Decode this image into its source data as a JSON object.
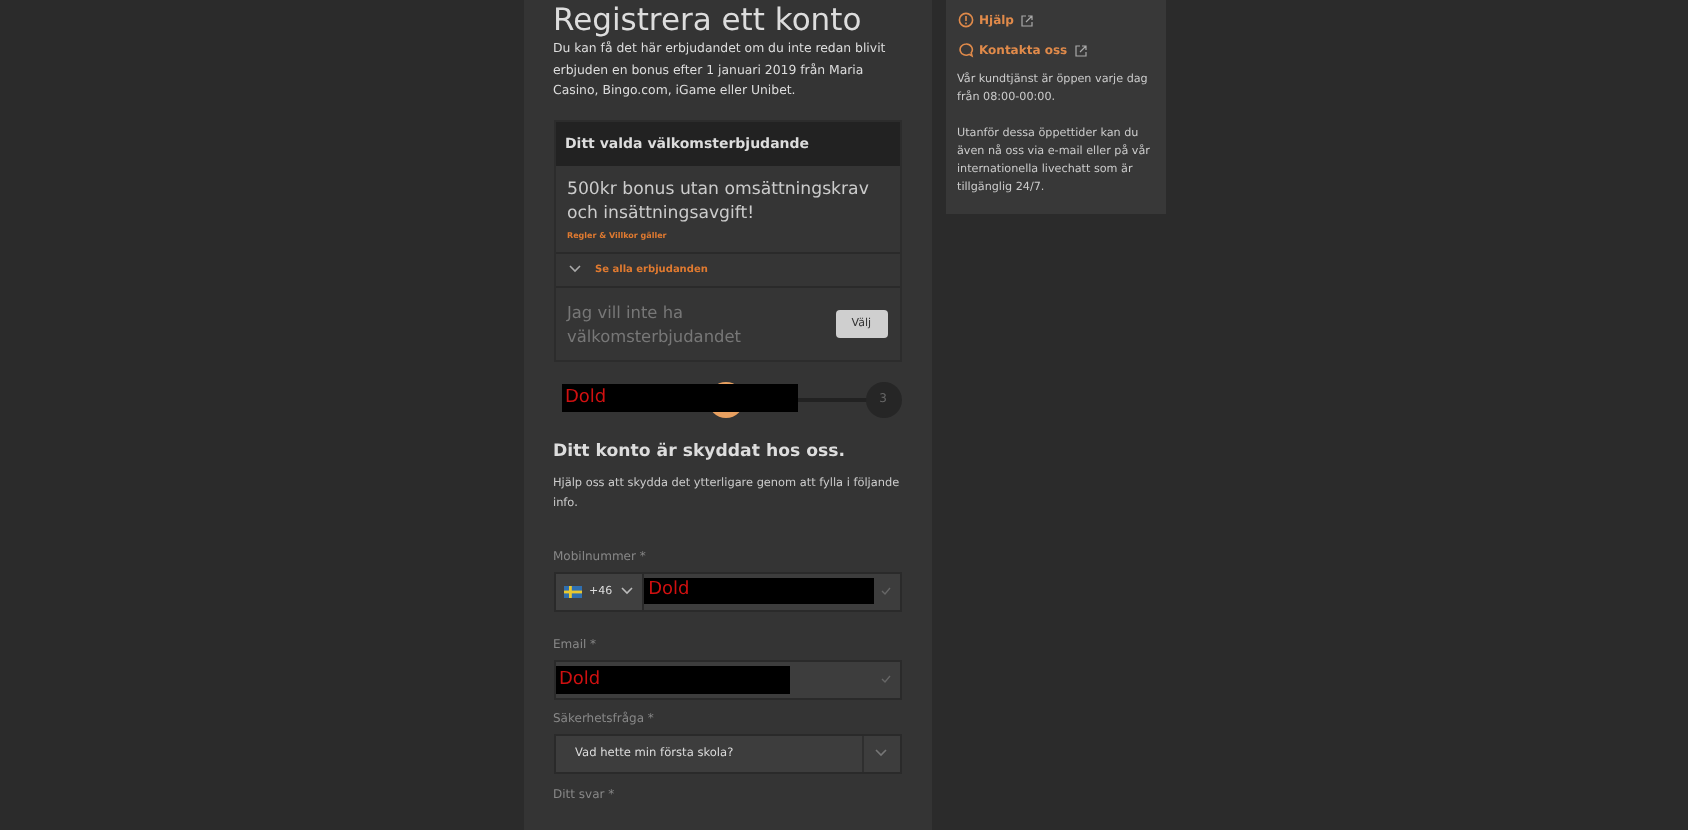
{
  "title": "Registrera ett konto",
  "intro": "Du kan få det här erbjudandet om du inte redan blivit erbjuden en bonus efter 1 januari 2019 från Maria Casino, Bingo.com, iGame eller Unibet.",
  "offer": {
    "header": "Ditt valda välkomsterbjudande",
    "text": "500kr bonus utan omsättningskrav och insättningsavgift!",
    "terms_link": "Regler & Villkor gäller",
    "see_all": "Se alla erbjudanden",
    "decline_text": "Jag vill inte ha välkomsterbjudandet",
    "choose_button": "Välj"
  },
  "stepper": {
    "redaction": "Dold",
    "steps": [
      {
        "selected": true
      },
      {
        "number": "3",
        "selected": false
      }
    ]
  },
  "security": {
    "heading": "Ditt konto är skyddat hos oss.",
    "text": "Hjälp oss att skydda det ytterligare genom att fylla i följande info."
  },
  "fields": [
    {
      "kind": "phone",
      "label": "Mobilnummer *",
      "prefix": "+46",
      "value": "Dold"
    },
    {
      "kind": "redacted",
      "label": "Email *",
      "value": "Dold"
    },
    {
      "kind": "select",
      "label": "Säkerhetsfråga *",
      "value": "Vad hette min första skola?"
    },
    {
      "kind": "label",
      "label": "Ditt svar *"
    }
  ],
  "side": {
    "links": [
      {
        "kind": "help",
        "label": "Hjälp"
      },
      {
        "kind": "chat",
        "label": "Kontakta oss"
      }
    ],
    "paragraphs": [
      "Vår kundtjänst är öppen varje dag från 08:00-00:00.",
      "Utanför dessa öppettider kan du även nå oss via e-mail eller på vår internationella livechatt som är tillgänglig 24/7."
    ]
  }
}
